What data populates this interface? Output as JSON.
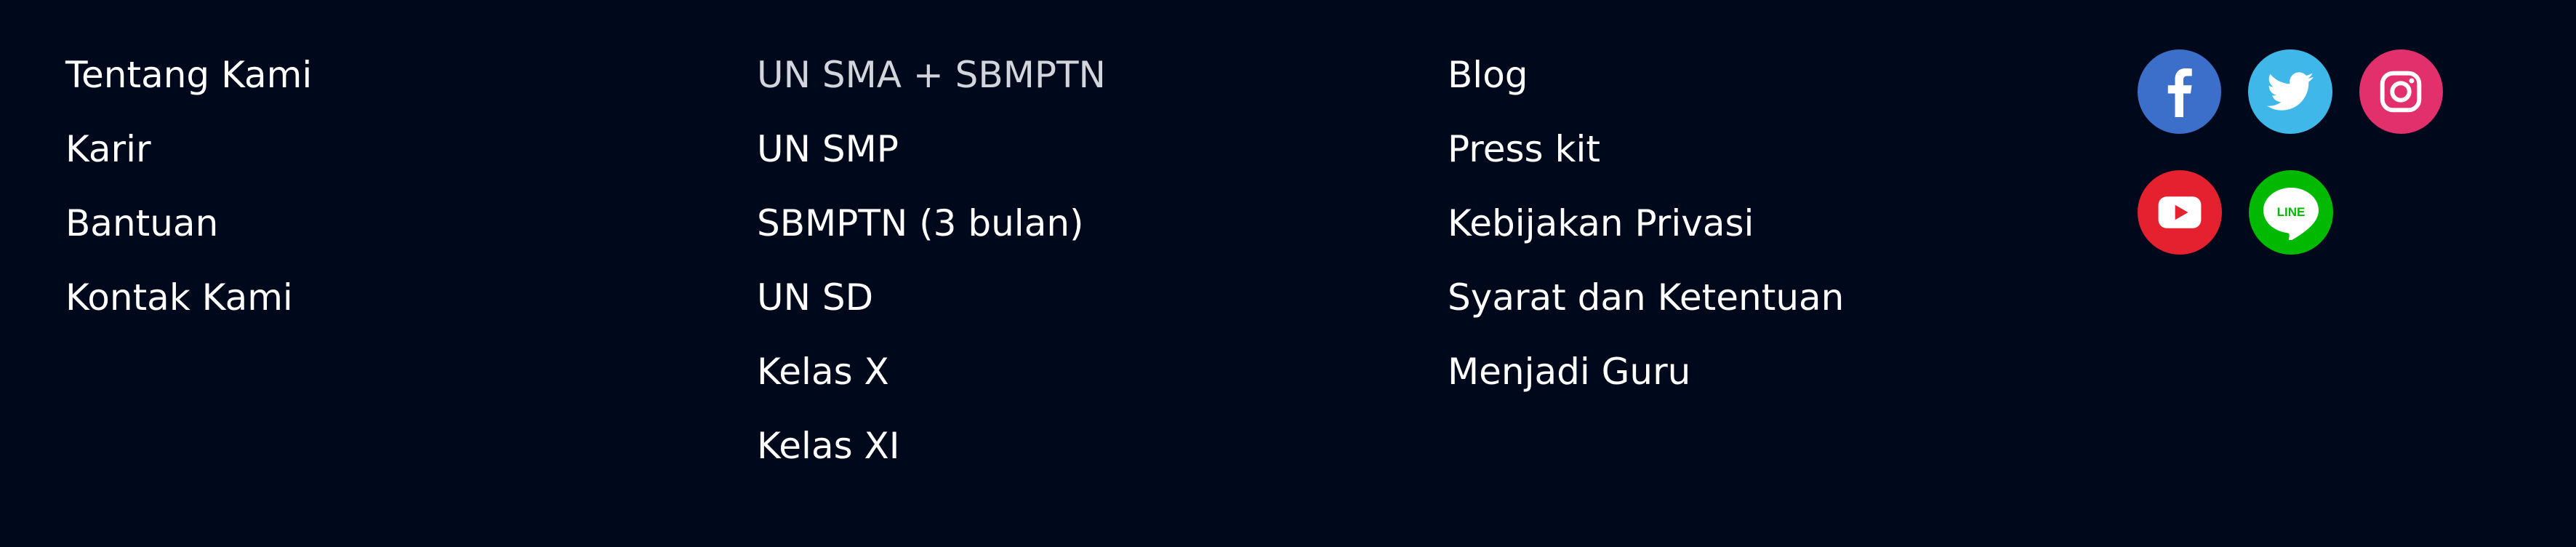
{
  "footer": {
    "company_links": [
      {
        "label": "Tentang Kami"
      },
      {
        "label": "Karir"
      },
      {
        "label": "Bantuan"
      },
      {
        "label": "Kontak Kami"
      }
    ],
    "program_links": [
      {
        "label": "UN SMA + SBMPTN"
      },
      {
        "label": "UN SMP"
      },
      {
        "label": "SBMPTN (3 bulan)"
      },
      {
        "label": "UN SD"
      },
      {
        "label": "Kelas X"
      },
      {
        "label": "Kelas XI"
      }
    ],
    "more_links": [
      {
        "label": "Blog"
      },
      {
        "label": "Press kit"
      },
      {
        "label": "Kebijakan Privasi"
      },
      {
        "label": "Syarat dan Ketentuan"
      },
      {
        "label": "Menjadi Guru"
      }
    ],
    "social": [
      {
        "icon": "facebook-icon",
        "color": "#3b6fc9"
      },
      {
        "icon": "twitter-icon",
        "color": "#3fb7e9"
      },
      {
        "icon": "instagram-icon",
        "color": "#e1306c"
      },
      {
        "icon": "youtube-icon",
        "color": "#e5202f"
      },
      {
        "icon": "line-icon",
        "color": "#00b900",
        "label": "LINE"
      }
    ],
    "colors": {
      "background": "#00081b",
      "text": "#ffffff",
      "muted_text": "#d2d6dc"
    }
  }
}
